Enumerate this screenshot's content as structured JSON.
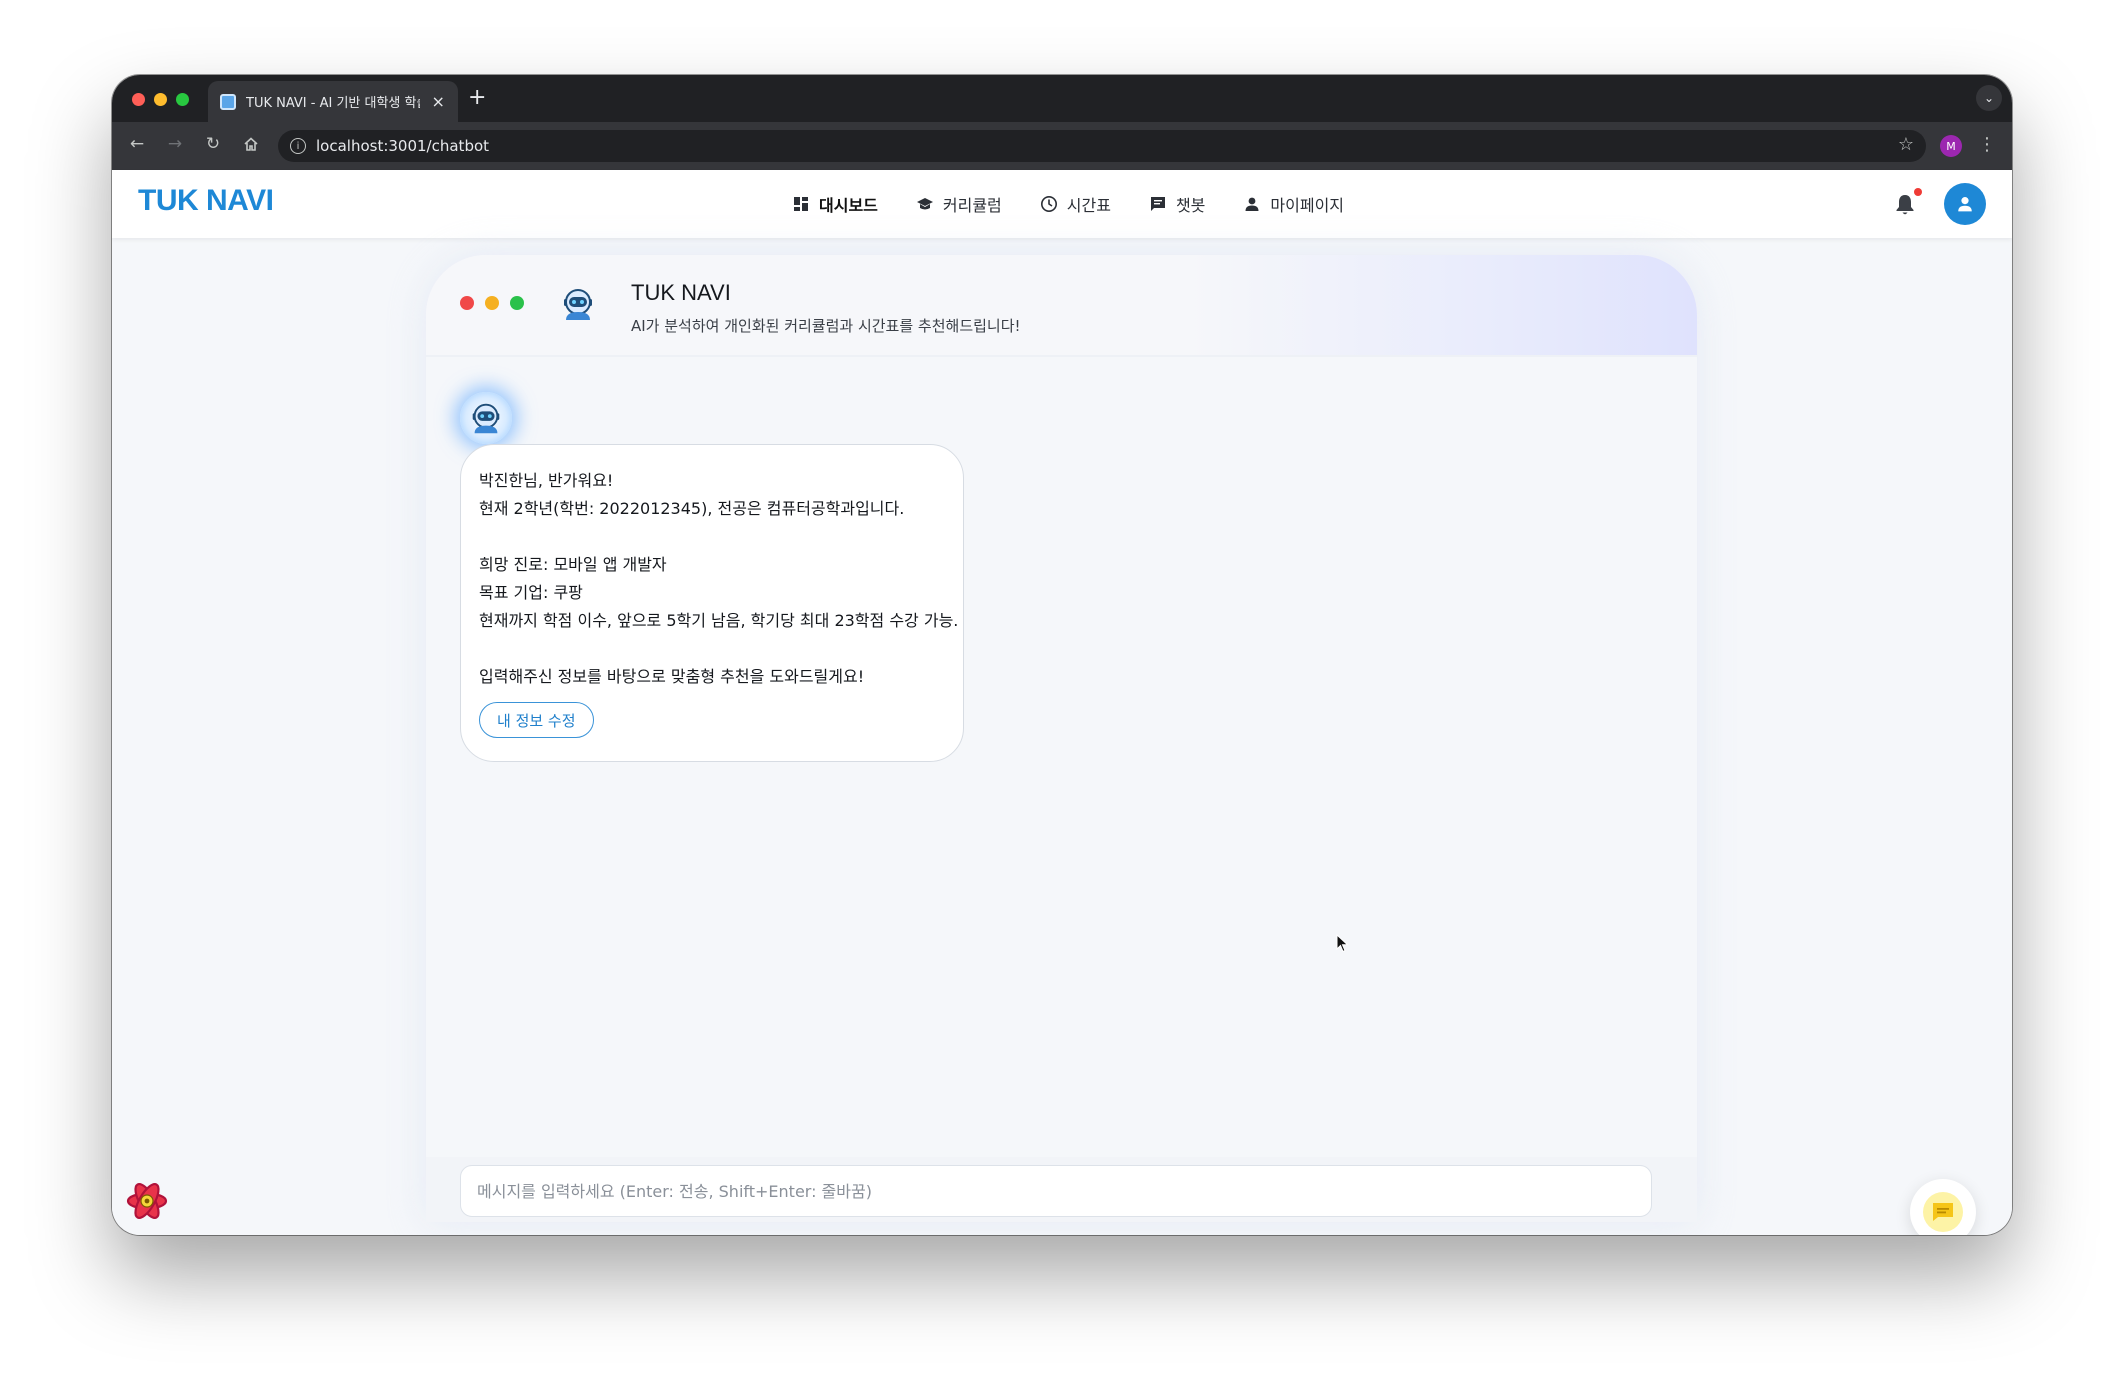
{
  "browser": {
    "tab_title": "TUK NAVI - AI 기반 대학생 학습",
    "url": "localhost:3001/chatbot",
    "profile_initial": "M"
  },
  "nav": {
    "brand": "TUK NAVI",
    "items": [
      {
        "label": "대시보드",
        "icon": "dashboard-icon",
        "active": true
      },
      {
        "label": "커리큘럼",
        "icon": "graduation-cap-icon",
        "active": false
      },
      {
        "label": "시간표",
        "icon": "clock-icon",
        "active": false
      },
      {
        "label": "챗봇",
        "icon": "chat-icon",
        "active": false
      },
      {
        "label": "마이페이지",
        "icon": "person-icon",
        "active": false
      }
    ]
  },
  "chat": {
    "title": "TUK NAVI",
    "subtitle": "AI가 분석하여 개인화된 커리큘럼과 시간표를 추천해드립니다!",
    "message": {
      "lines": [
        "박진한님, 반가워요!",
        "현재 2학년(학번: 2022012345), 전공은 컴퓨터공학과입니다.",
        "",
        "희망 진로: 모바일 앱 개발자",
        "목표 기업: 쿠팡",
        "현재까지 학점 이수, 앞으로 5학기 남음, 학기당 최대 23학점 수강 가능.",
        "",
        "입력해주신 정보를 바탕으로 맞춤형 추천을 도와드릴게요!"
      ],
      "edit_button": "내 정보 수정"
    },
    "input_placeholder": "메시지를 입력하세요 (Enter: 전송, Shift+Enter: 줄바꿈)"
  },
  "colors": {
    "brand": "#1e88d6",
    "notification_dot": "#ef3b36",
    "fab_accent": "#f5c518"
  }
}
